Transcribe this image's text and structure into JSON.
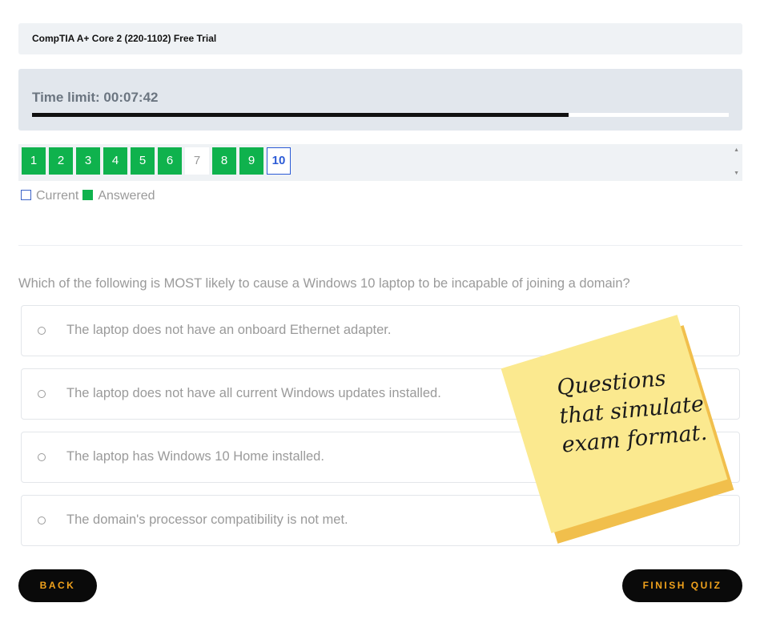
{
  "header": {
    "title": "CompTIA A+ Core 2 (220-1102) Free Trial"
  },
  "timer": {
    "label": "Time limit: 00:07:42",
    "progress_fraction": 0.77
  },
  "question_nav": {
    "items": [
      {
        "label": "1",
        "state": "answered"
      },
      {
        "label": "2",
        "state": "answered"
      },
      {
        "label": "3",
        "state": "answered"
      },
      {
        "label": "4",
        "state": "answered"
      },
      {
        "label": "5",
        "state": "answered"
      },
      {
        "label": "6",
        "state": "answered"
      },
      {
        "label": "7",
        "state": "unanswered"
      },
      {
        "label": "8",
        "state": "answered"
      },
      {
        "label": "9",
        "state": "answered"
      },
      {
        "label": "10",
        "state": "current"
      }
    ]
  },
  "legend": {
    "current_label": "Current",
    "answered_label": "Answered"
  },
  "question": {
    "text": "Which of the following is MOST likely to cause a Windows 10 laptop to be incapable of joining a domain?",
    "answers": [
      "The laptop does not have an onboard Ethernet adapter.",
      "The laptop does not have all current Windows updates installed.",
      "The laptop has Windows 10 Home installed.",
      "The domain's processor compatibility is not met."
    ]
  },
  "buttons": {
    "back_label": "BACK",
    "finish_label": "FINISH QUIZ"
  },
  "sticky_note": {
    "text": "Questions\nthat simulate\nexam format."
  },
  "colors": {
    "answered": "#0fb24d",
    "current_border": "#2c5bd6",
    "button_bg": "#0a0a0a",
    "button_text": "#f1a21c",
    "sticky": "#fbe98f"
  }
}
